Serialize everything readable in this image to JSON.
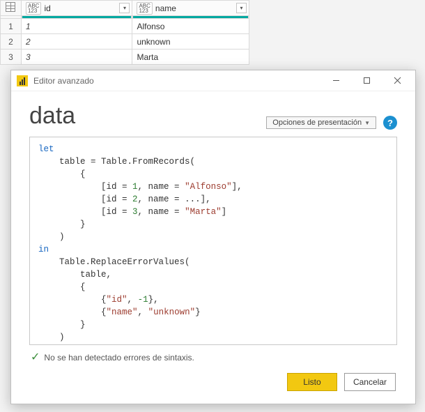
{
  "grid": {
    "columns": {
      "id": "id",
      "name": "name"
    },
    "type_hint": {
      "top": "ABC",
      "bottom": "123"
    },
    "rows": [
      {
        "n": "1",
        "id": "1",
        "name": "Alfonso"
      },
      {
        "n": "2",
        "id": "2",
        "name": "unknown"
      },
      {
        "n": "3",
        "id": "3",
        "name": "Marta"
      }
    ]
  },
  "dialog": {
    "title": "Editor avanzado",
    "heading": "data",
    "options_label": "Opciones de presentación",
    "help_glyph": "?",
    "status_text": "No se han detectado errores de sintaxis.",
    "buttons": {
      "ok": "Listo",
      "cancel": "Cancelar"
    },
    "code": {
      "let": "let",
      "l1a": "    table = Table.FromRecords(",
      "l2": "        {",
      "l3a": "            [id = ",
      "l3b": ", name = ",
      "l3c": "],",
      "v1_id": "1",
      "v1_name": "\"Alfonso\"",
      "v2_id": "2",
      "v2_name": "...",
      "v3_id": "3",
      "v3_name": "\"Marta\"",
      "l4": "            [id = ",
      "l4b": ", name = ",
      "l4c": "],",
      "l5": "            [id = ",
      "l5b": ", name = ",
      "l5c": "]",
      "l6": "        }",
      "l7": "    )",
      "in": "in",
      "l8": "    Table.ReplaceErrorValues(",
      "l9": "        table,",
      "l10": "        {",
      "l11a": "            {",
      "l11b": "\"id\"",
      "l11c": ", ",
      "l11d": "-1",
      "l11e": "},",
      "l12a": "            {",
      "l12b": "\"name\"",
      "l12c": ", ",
      "l12d": "\"unknown\"",
      "l12e": "}",
      "l13": "        }",
      "l14": "    )"
    }
  }
}
